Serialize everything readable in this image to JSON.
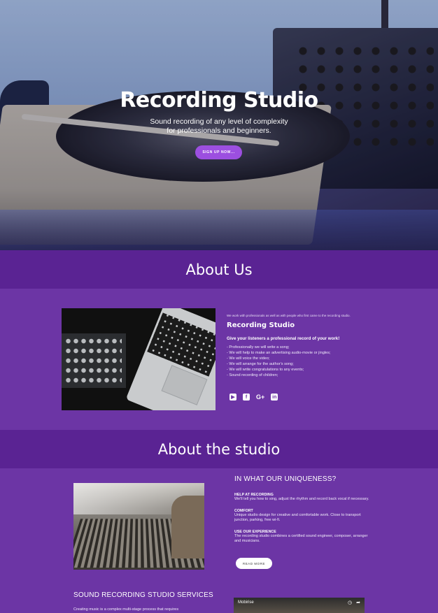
{
  "hero": {
    "title": "Recording Studio",
    "subtitle_line1": "Sound recording of any level of complexity",
    "subtitle_line2": "for professionals and beginners.",
    "button_label": "SIGN UP NOW..."
  },
  "about_us": {
    "heading": "About Us",
    "small_text": "We work with professionals as well as with people who first came to the recording studio.",
    "name": "Recording Studio",
    "lead": "Give your listeners a professional record of your work!",
    "items": [
      "- Professionally we will write a song;",
      "- We will help to make an advertising audio-movie or jingles;",
      "- We will voice the video;",
      "- We will arrange for the author's song;",
      "- We will write congratulations to any events;",
      "- Sound recording of children;"
    ],
    "social": [
      {
        "icon": "youtube-icon",
        "glyph": "▶"
      },
      {
        "icon": "facebook-icon",
        "glyph": "f"
      },
      {
        "icon": "google-plus-icon",
        "glyph": "G+"
      },
      {
        "icon": "linkedin-icon",
        "glyph": "in"
      }
    ]
  },
  "studio": {
    "heading": "About the studio",
    "uniqueness_title": "IN WHAT OUR UNIQUENESS?",
    "features": [
      {
        "title": "HELP AT RECORDING",
        "text": "We'll tell you how to sing, adjust the rhythm and record back vocal if necessary."
      },
      {
        "title": "COMFORT",
        "text": "Unique studio design for creative and comfortable work. Close to transport junction, parking, free wi-fi."
      },
      {
        "title": "USE OUR EXPERIENCE",
        "text": "The recording studio combines a certified sound engineer, composer, arranger and musicians."
      }
    ],
    "read_more_label": "READ MORE",
    "services_title": "SOUND RECORDING STUDIO SERVICES",
    "services_text": "Creating music is a complex multi-stage process that requires",
    "video_title": "Mobirise"
  },
  "colors": {
    "background": "#6c35a5",
    "band": "#5a2393",
    "button": "#9c4fe0"
  }
}
